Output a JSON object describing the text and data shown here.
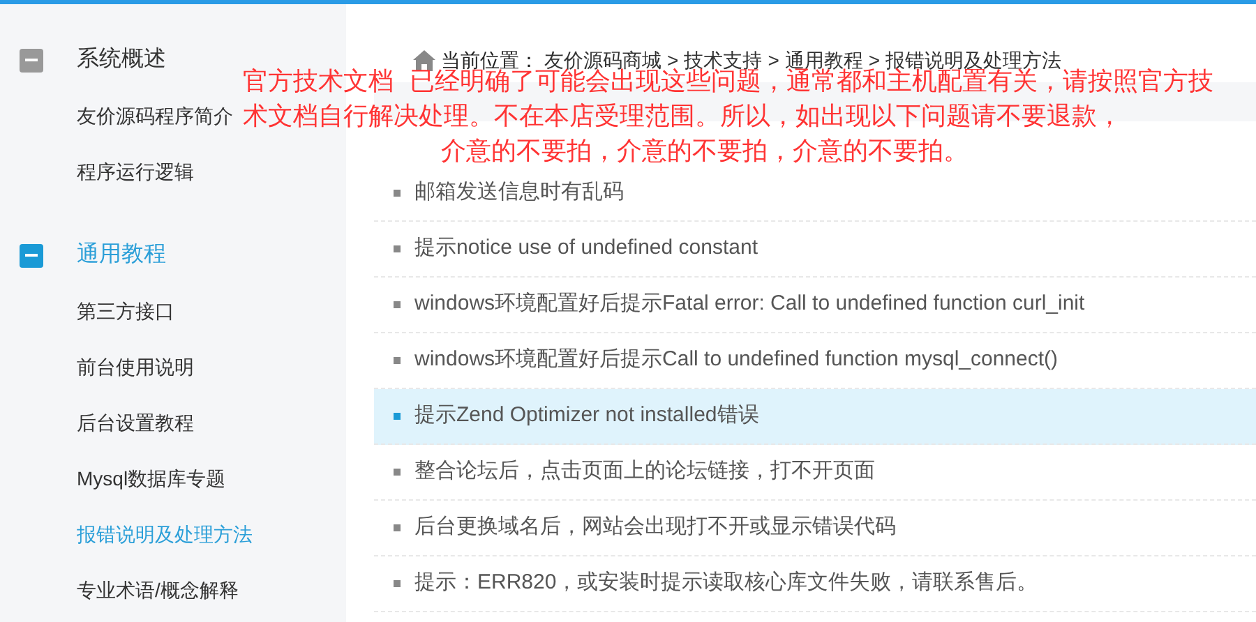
{
  "sidebar": {
    "groups": [
      {
        "label": "系统概述",
        "selected": false,
        "items": [
          {
            "label": "友价源码程序简介",
            "selected": false
          },
          {
            "label": "程序运行逻辑",
            "selected": false
          }
        ]
      },
      {
        "label": "通用教程",
        "selected": true,
        "items": [
          {
            "label": "第三方接口",
            "selected": false
          },
          {
            "label": "前台使用说明",
            "selected": false
          },
          {
            "label": "后台设置教程",
            "selected": false
          },
          {
            "label": "Mysql数据库专题",
            "selected": false
          },
          {
            "label": "报错说明及处理方法",
            "selected": true
          },
          {
            "label": "专业术语/概念解释",
            "selected": false
          }
        ]
      }
    ]
  },
  "breadcrumb": {
    "label": "当前位置：",
    "items": [
      "友价源码商城",
      "技术支持",
      "通用教程",
      "报错说明及处理方法"
    ],
    "separator": ">"
  },
  "notice": {
    "lines": [
      "官方技术文档  已经明确了可能会出现这些问题，通常都和主机配置有关，请按照官方技",
      "术文档自行解决处理。不在本店受理范围。所以，如出现以下问题请不要退款，",
      "介意的不要拍，介意的不要拍，介意的不要拍。"
    ]
  },
  "articles": [
    {
      "title": "邮箱发送信息时有乱码",
      "selected": false
    },
    {
      "title": "提示notice use of undefined constant",
      "selected": false
    },
    {
      "title": "windows环境配置好后提示Fatal error: Call to undefined function curl_init",
      "selected": false
    },
    {
      "title": "windows环境配置好后提示Call to undefined function mysql_connect()",
      "selected": false
    },
    {
      "title": "提示Zend Optimizer not installed错误",
      "selected": true
    },
    {
      "title": "整合论坛后，点击页面上的论坛链接，打不开页面",
      "selected": false
    },
    {
      "title": "后台更换域名后，网站会出现打不开或显示错误代码",
      "selected": false
    },
    {
      "title": "提示：ERR820，或安装时提示读取核心库文件失败，请联系售后。",
      "selected": false
    }
  ]
}
